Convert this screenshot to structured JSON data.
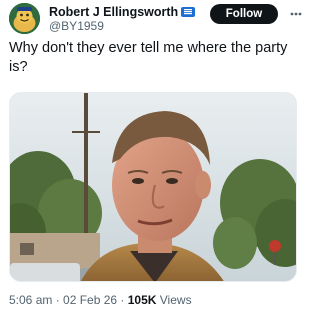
{
  "author": {
    "display_name": "Robert J Ellingsworth",
    "handle": "@BY1959",
    "avatar_icon": "cartoon-avatar",
    "verified_badge_icon": "gov-badge-icon"
  },
  "actions": {
    "follow_label": "Follow",
    "more_icon": "more-dots-icon"
  },
  "tweet": {
    "text": "Why don't they ever tell me where the party is?",
    "media_description_icon": "photo"
  },
  "meta": {
    "time": "5:06 am",
    "separator1": " · ",
    "date": "02 Feb 26",
    "separator2": " · ",
    "views_count": "105K",
    "views_label": " Views"
  },
  "colors": {
    "text_primary": "#0f1419",
    "text_secondary": "#536471",
    "follow_bg": "#0f1419",
    "badge": "#1d6fd1"
  }
}
